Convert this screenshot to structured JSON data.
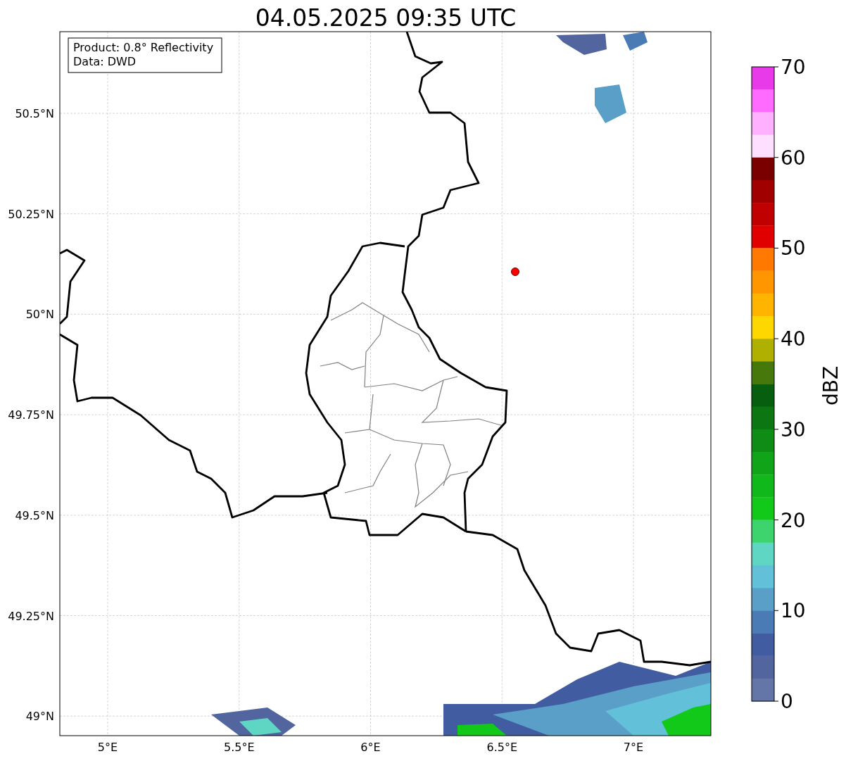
{
  "title": "04.05.2025 09:35 UTC",
  "info_box": {
    "lines": [
      "Product: 0.8° Reflectivity",
      "Data: DWD"
    ]
  },
  "map": {
    "x_ticks": [
      "5°E",
      "5.5°E",
      "6°E",
      "6.5°E",
      "7°E"
    ],
    "y_ticks": [
      "50.5°N",
      "50.25°N",
      "50°N",
      "49.75°N",
      "49.5°N",
      "49.25°N",
      "49°N"
    ]
  },
  "colorbar": {
    "label": "dBZ",
    "ticks": [
      "70",
      "60",
      "50",
      "40",
      "30",
      "20",
      "10",
      "0"
    ],
    "bands": [
      {
        "color": "#e83ae8"
      },
      {
        "color": "#ff6aff"
      },
      {
        "color": "#ffb0ff"
      },
      {
        "color": "#ffdfff"
      },
      {
        "color": "#7a0000"
      },
      {
        "color": "#a00000"
      },
      {
        "color": "#c00000"
      },
      {
        "color": "#e00000"
      },
      {
        "color": "#ff7800"
      },
      {
        "color": "#ff9600"
      },
      {
        "color": "#ffb400"
      },
      {
        "color": "#ffd700"
      },
      {
        "color": "#b0b000"
      },
      {
        "color": "#46780b"
      },
      {
        "color": "#075e0e"
      },
      {
        "color": "#0b7612"
      },
      {
        "color": "#0e8c15"
      },
      {
        "color": "#10a418"
      },
      {
        "color": "#11b81b"
      },
      {
        "color": "#12c818"
      },
      {
        "color": "#3dd46e"
      },
      {
        "color": "#5fd6c4"
      },
      {
        "color": "#62c0d9"
      },
      {
        "color": "#5a9fc8"
      },
      {
        "color": "#4a7bb4"
      },
      {
        "color": "#415ca0"
      },
      {
        "color": "#52659f"
      },
      {
        "color": "#6475a8"
      }
    ]
  }
}
